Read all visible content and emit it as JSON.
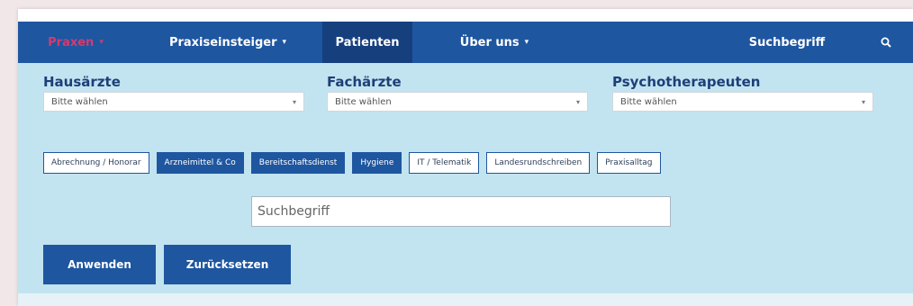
{
  "nav": {
    "items": [
      {
        "label": "Praxen",
        "has_dropdown": true
      },
      {
        "label": "Praxiseinsteiger",
        "has_dropdown": true
      },
      {
        "label": "Patienten",
        "has_dropdown": false
      },
      {
        "label": "Über uns",
        "has_dropdown": true
      }
    ],
    "dropdown_arrow": "▾",
    "search_label": "Suchbegriff",
    "search_icon": "search-icon"
  },
  "filters": [
    {
      "title": "Hausärzte",
      "value": "Bitte wählen"
    },
    {
      "title": "Fachärzte",
      "value": "Bitte wählen"
    },
    {
      "title": "Psychotherapeuten",
      "value": "Bitte wählen"
    }
  ],
  "select_arrow": "▾",
  "tags": [
    {
      "label": "Abrechnung / Honorar",
      "selected": false
    },
    {
      "label": "Arzneimittel & Co",
      "selected": true
    },
    {
      "label": "Bereitschaftsdienst",
      "selected": true
    },
    {
      "label": "Hygiene",
      "selected": true
    },
    {
      "label": "IT / Telematik",
      "selected": false
    },
    {
      "label": "Landesrundschreiben",
      "selected": false
    },
    {
      "label": "Praxisalltag",
      "selected": false
    }
  ],
  "search": {
    "placeholder": "Suchbegriff"
  },
  "buttons": {
    "apply": "Anwenden",
    "reset": "Zurücksetzen"
  },
  "colors": {
    "primary": "#1e56a0",
    "active_nav": "#163f7e",
    "accent_red": "#d63a6e",
    "panel_bg": "#c2e4f0"
  }
}
